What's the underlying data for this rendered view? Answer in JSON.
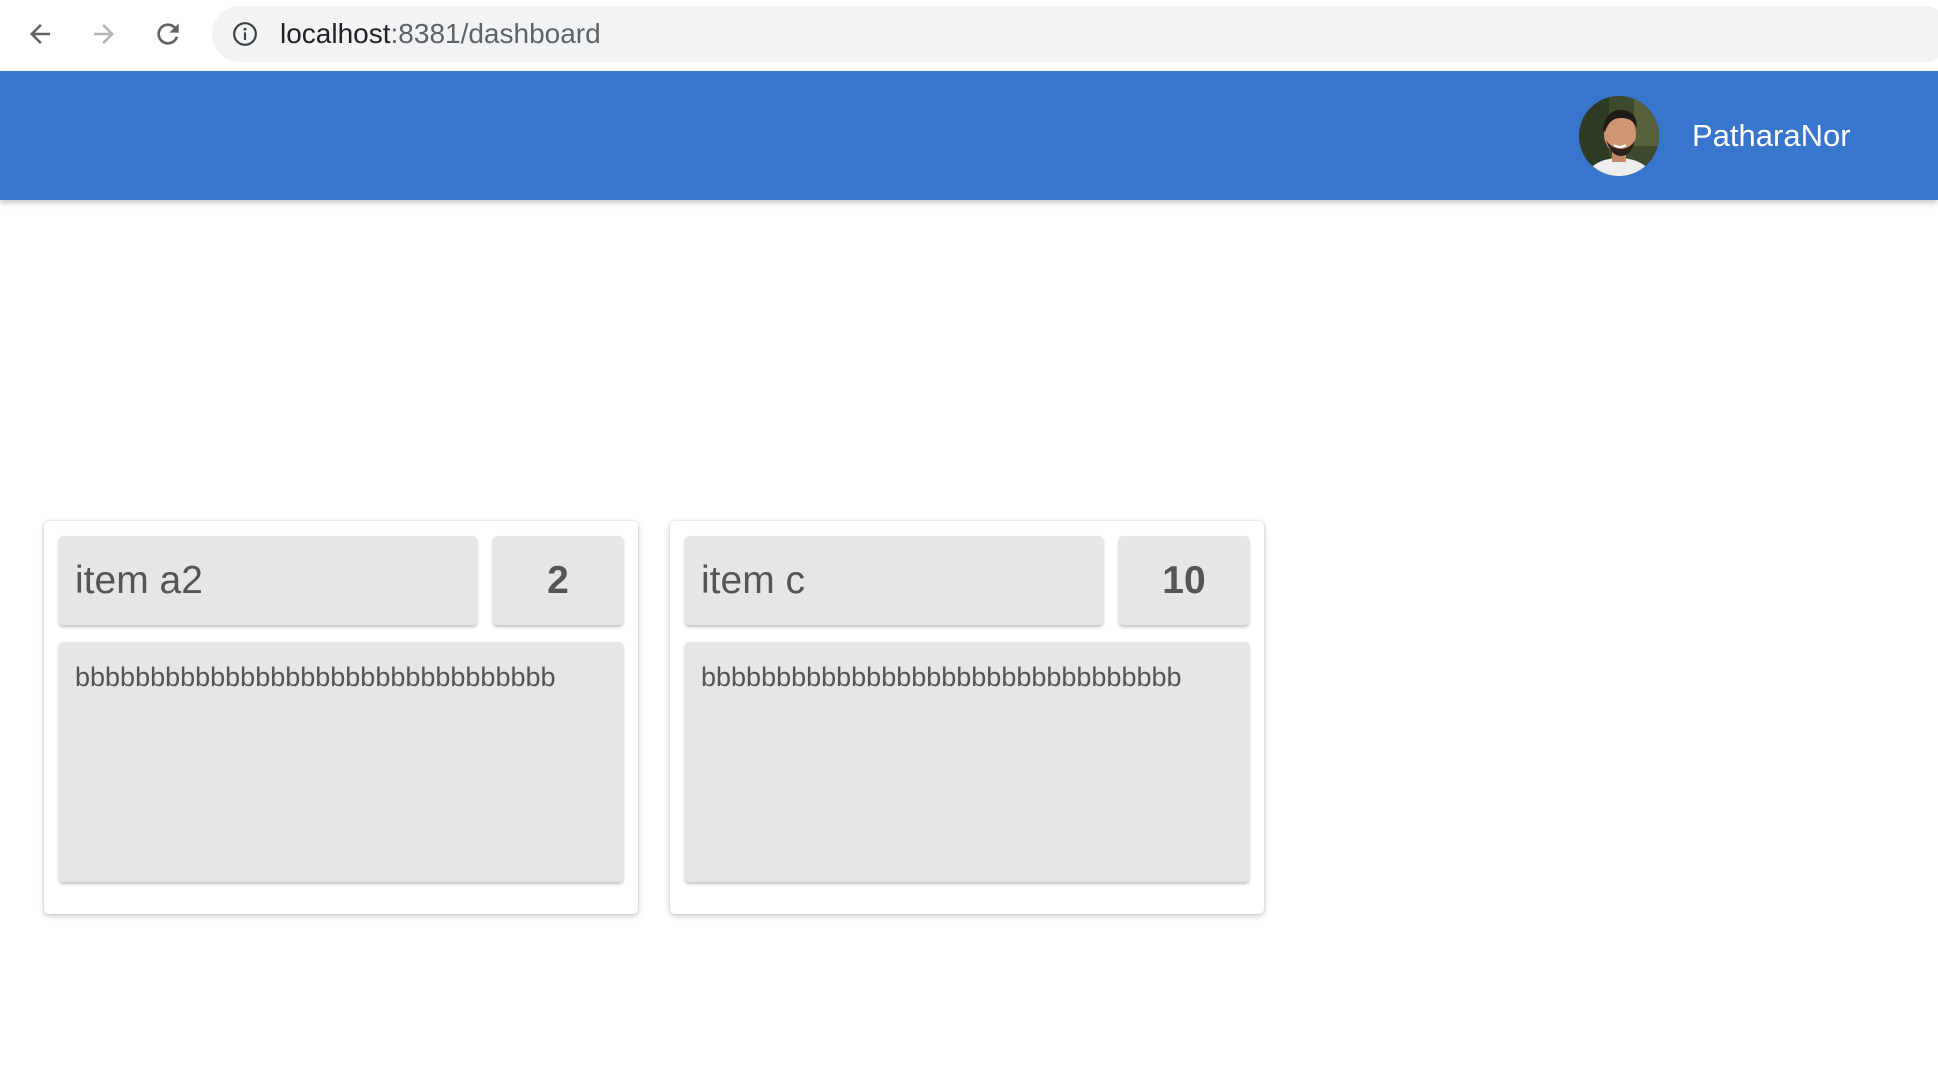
{
  "browser": {
    "url_host": "localhost",
    "url_rest": ":8381/dashboard",
    "icons": {
      "back": "arrow-left-icon",
      "forward": "arrow-right-icon",
      "reload": "reload-icon",
      "info": "info-icon"
    }
  },
  "header": {
    "background_color": "#3875cd",
    "user_name": "PatharaNor",
    "avatar": "user-avatar"
  },
  "cards": [
    {
      "title": "item a2",
      "count": "2",
      "body": "bbbbbbbbbbbbbbbbbbbbbbbbbbbbbbbb"
    },
    {
      "title": "item c",
      "count": "10",
      "body": "bbbbbbbbbbbbbbbbbbbbbbbbbbbbbbbb"
    }
  ]
}
